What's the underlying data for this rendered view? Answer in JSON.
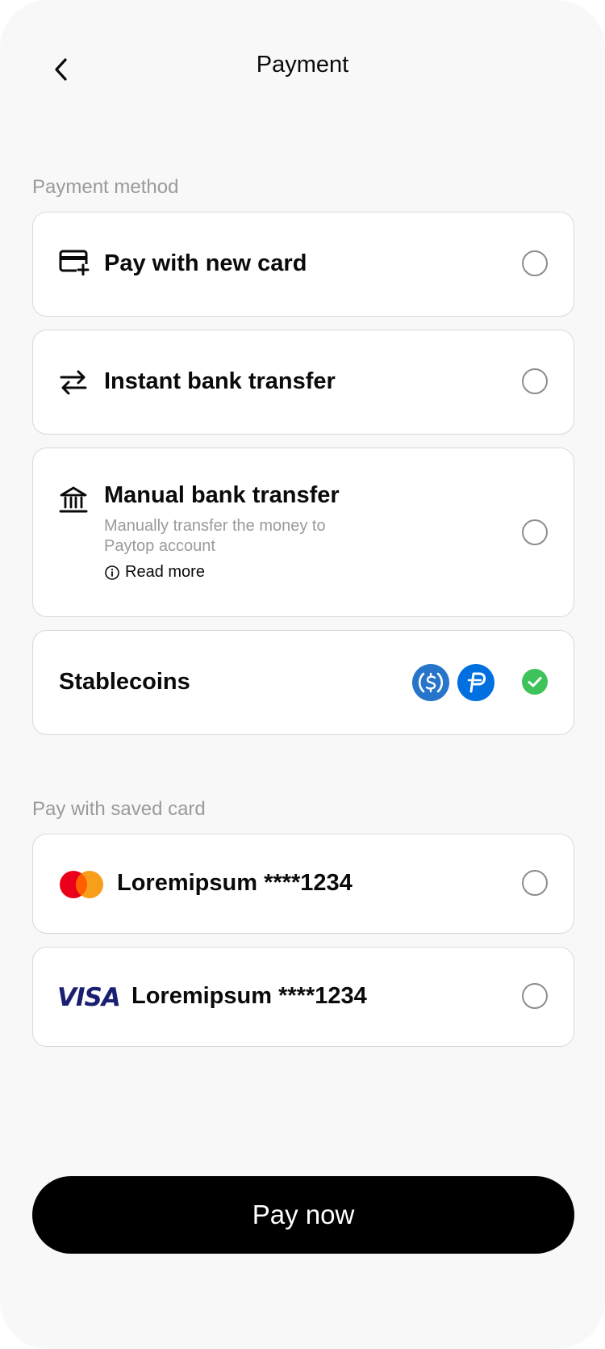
{
  "header": {
    "title": "Payment",
    "back_icon": "chevron-left-icon"
  },
  "sections": {
    "payment_method": "Payment method",
    "saved_card": "Pay with saved card"
  },
  "methods": {
    "new_card": {
      "label": "Pay with new card",
      "icon": "card-plus-icon",
      "selected": false
    },
    "instant_bank": {
      "label": "Instant bank transfer",
      "icon": "arrows-swap-icon",
      "selected": false
    },
    "manual_bank": {
      "label": "Manual bank transfer",
      "icon": "bank-icon",
      "description": "Manually transfer the money to Paytop account",
      "read_more": "Read more",
      "selected": false
    },
    "stablecoins": {
      "label": "Stablecoins",
      "coins": [
        "usdc-icon",
        "pyusd-icon"
      ],
      "selected": true
    }
  },
  "saved_cards": [
    {
      "brand": "mastercard-logo",
      "label": "Loremipsum ****1234",
      "selected": false
    },
    {
      "brand": "VISA",
      "label": "Loremipsum ****1234",
      "selected": false
    }
  ],
  "pay_button": "Pay now",
  "colors": {
    "accent": "#000000",
    "check": "#3ec25a",
    "coin_blue": "#2775ca",
    "paypal_blue": "#0070e0",
    "mastercard_red": "#eb001b",
    "mastercard_orange": "#f79e1b",
    "visa_navy": "#1a1f71"
  }
}
